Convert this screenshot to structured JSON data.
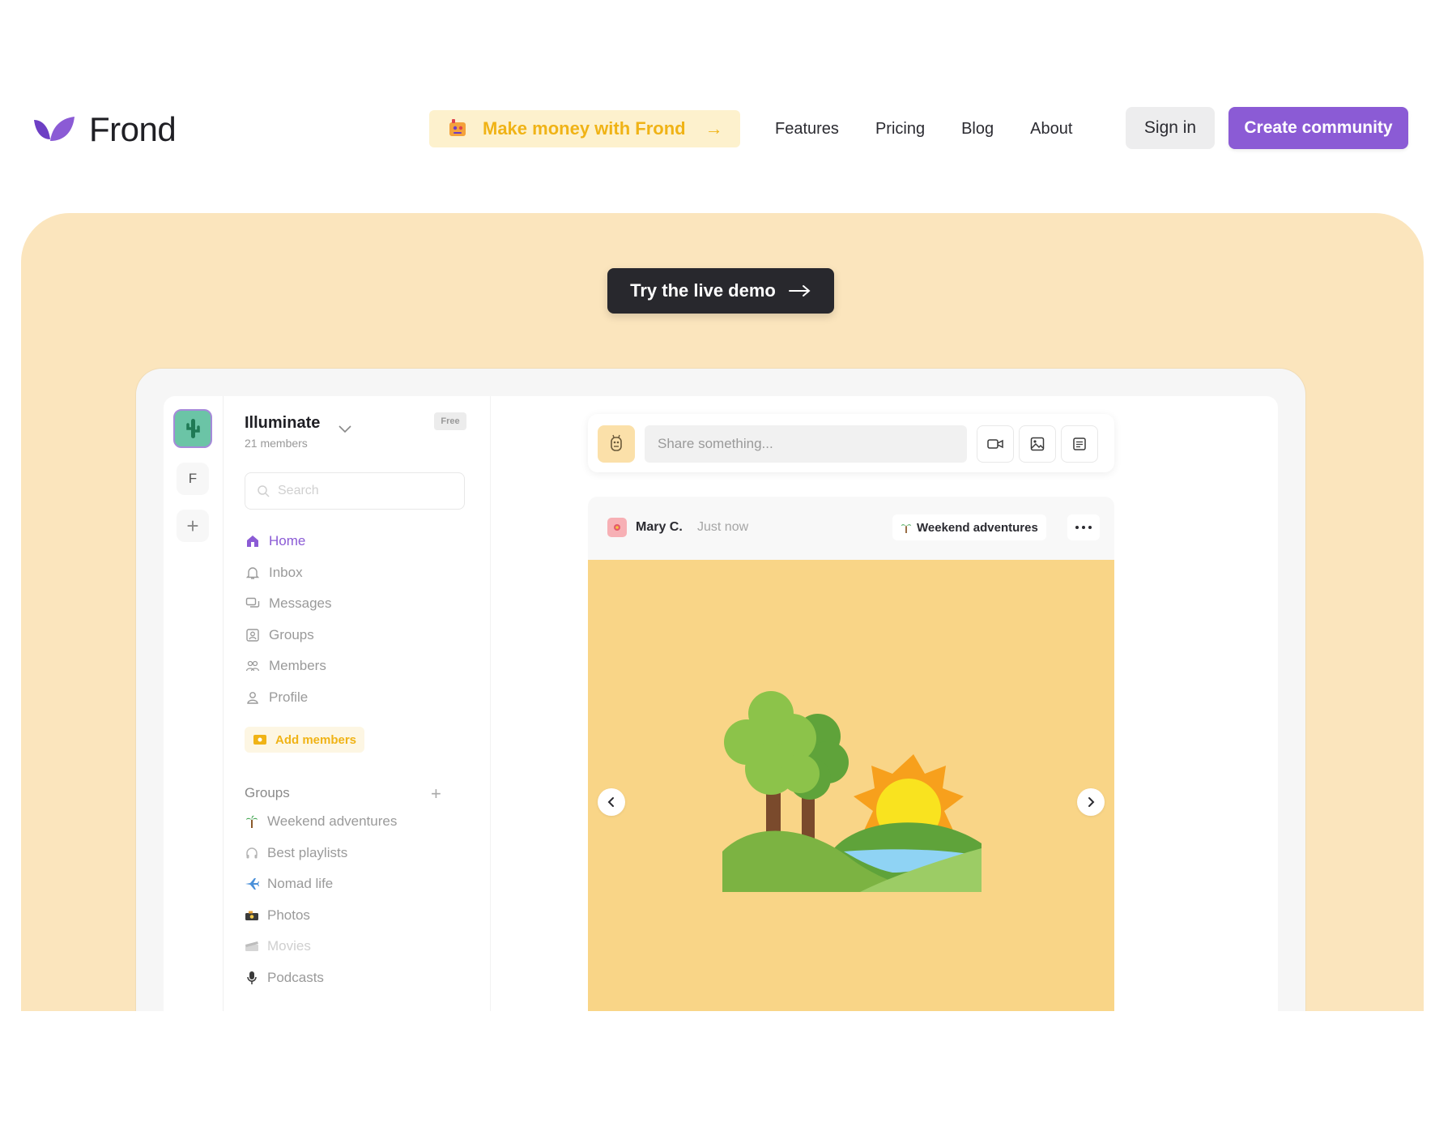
{
  "nav": {
    "brand": "Frond",
    "promo_label": "Make money with Frond",
    "promo_arrow": "→",
    "links": [
      "Features",
      "Pricing",
      "Blog",
      "About"
    ],
    "sign_in": "Sign in",
    "create": "Create community"
  },
  "hero": {
    "demo_label": "Try the live demo"
  },
  "app": {
    "rail": {
      "letter": "F",
      "plus": "+"
    },
    "workspace": {
      "name": "Illuminate",
      "members": "21 members",
      "plan": "Free"
    },
    "search_placeholder": "Search",
    "menu": [
      {
        "label": "Home",
        "icon": "home-icon",
        "active": true
      },
      {
        "label": "Inbox",
        "icon": "bell-icon"
      },
      {
        "label": "Messages",
        "icon": "messages-icon"
      },
      {
        "label": "Groups",
        "icon": "groups-icon"
      },
      {
        "label": "Members",
        "icon": "members-icon"
      },
      {
        "label": "Profile",
        "icon": "profile-icon"
      }
    ],
    "add_members": "Add members",
    "groups_title": "Groups",
    "groups_plus": "+",
    "groups": [
      {
        "label": "Weekend adventures",
        "icon": "palm-tree-icon"
      },
      {
        "label": "Best playlists",
        "icon": "headphones-icon"
      },
      {
        "label": "Nomad life",
        "icon": "airplane-icon"
      },
      {
        "label": "Photos",
        "icon": "camera-icon"
      },
      {
        "label": "Movies",
        "icon": "film-icon",
        "faded": true
      },
      {
        "label": "Podcasts",
        "icon": "microphone-icon"
      }
    ],
    "composer_placeholder": "Share something...",
    "post": {
      "author": "Mary C.",
      "time": "Just now",
      "group": "Weekend adventures"
    }
  },
  "colors": {
    "accent": "#8b5bd5",
    "hero_bg": "#fbe5bd",
    "promo_text": "#f0b316",
    "post_image_bg": "#f9d587"
  }
}
